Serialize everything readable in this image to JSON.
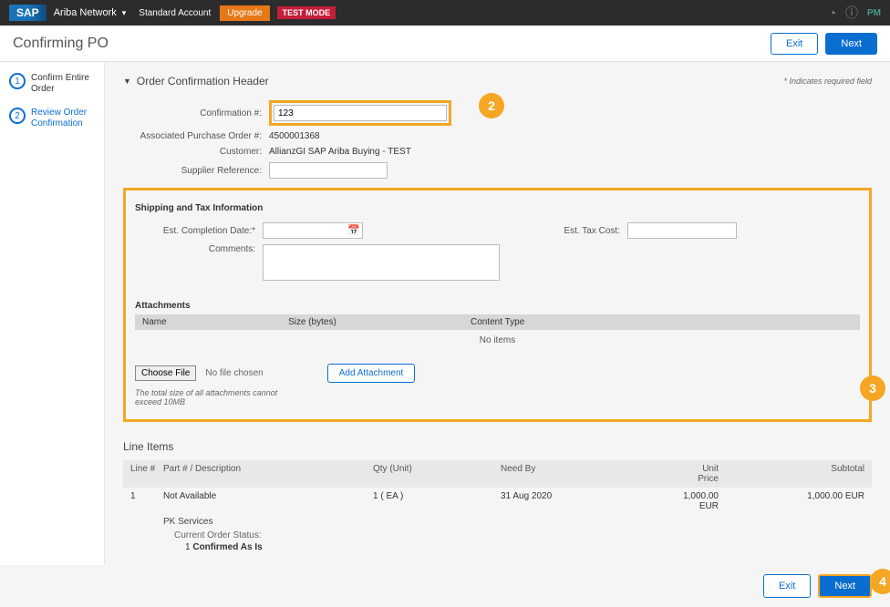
{
  "topbar": {
    "brand": "SAP",
    "title": "Ariba Network",
    "account_type": "Standard Account",
    "upgrade": "Upgrade",
    "test_mode": "TEST MODE",
    "user_initials": "PM"
  },
  "subheader": {
    "title": "Confirming PO",
    "exit": "Exit",
    "next": "Next"
  },
  "wizard": {
    "step1": {
      "num": "1",
      "label": "Confirm Entire Order"
    },
    "step2": {
      "num": "2",
      "label": "Review Order Confirmation"
    }
  },
  "section": {
    "title": "Order Confirmation Header",
    "required_note": "* Indicates required field"
  },
  "header_form": {
    "confirmation_label": "Confirmation #:",
    "confirmation_value": "123",
    "po_label": "Associated Purchase Order #:",
    "po_value": "4500001368",
    "customer_label": "Customer:",
    "customer_value": "AllianzGI SAP Ariba Buying - TEST",
    "supplier_ref_label": "Supplier Reference:",
    "supplier_ref_value": ""
  },
  "shipping": {
    "title": "Shipping and Tax Information",
    "completion_label": "Est. Completion Date:*",
    "completion_value": "",
    "comments_label": "Comments:",
    "comments_value": "",
    "tax_label": "Est. Tax Cost:",
    "tax_value": ""
  },
  "attachments": {
    "title": "Attachments",
    "col_name": "Name",
    "col_size": "Size (bytes)",
    "col_type": "Content Type",
    "no_items": "No items",
    "choose_file": "Choose File",
    "no_file": "No file chosen",
    "add_attachment": "Add Attachment",
    "note": "The total size of all attachments cannot exceed 10MB"
  },
  "line_items": {
    "title": "Line Items",
    "cols": {
      "line": "Line #",
      "part": "Part # / Description",
      "qty": "Qty (Unit)",
      "need": "Need By",
      "price": "Unit Price",
      "subtotal": "Subtotal"
    },
    "row": {
      "line": "1",
      "part": "Not Available",
      "desc": "PK Services",
      "qty": "1 ( EA )",
      "need": "31 Aug 2020",
      "price": "1,000.00 EUR",
      "subtotal": "1,000.00 EUR",
      "status_label": "Current Order Status:",
      "status_line": "1",
      "status_text": "Confirmed As Is"
    }
  },
  "footer": {
    "exit": "Exit",
    "next": "Next"
  },
  "callouts": {
    "c2": "2",
    "c3": "3",
    "c4": "4"
  }
}
